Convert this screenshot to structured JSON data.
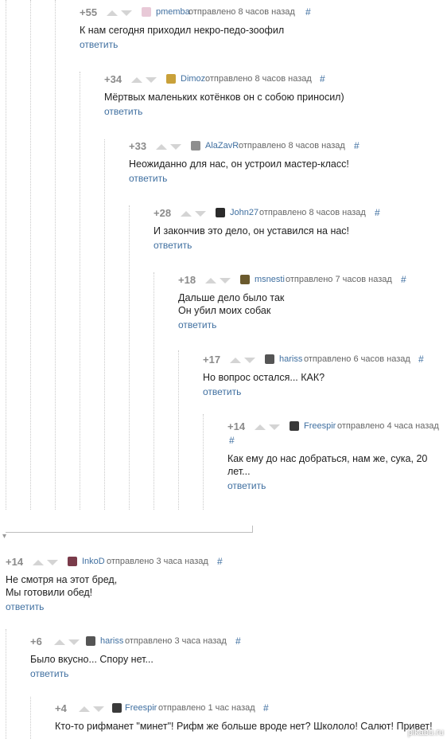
{
  "reply_label": "ответить",
  "hash": "#",
  "watermark": "pikabu.ru",
  "comments": [
    {
      "rating": "+55",
      "author": "pmemba",
      "time": "отправлено 8 часов назад",
      "text": "К нам сегодня приходил некро-педо-зоофил",
      "avatar_color": "#e8c9d7"
    },
    {
      "rating": "+34",
      "author": "Dimoz",
      "time": "отправлено 8 часов назад",
      "text": "Мёртвых маленьких котёнков он с собою приносил)",
      "avatar_color": "#c9a13a"
    },
    {
      "rating": "+33",
      "author": "AlaZavR",
      "time": "отправлено 8 часов назад",
      "text": "Неожиданно для нас, он устроил мастер-класс!",
      "avatar_color": "#8e8e8e"
    },
    {
      "rating": "+28",
      "author": "John27",
      "time": "отправлено 8 часов назад",
      "text": "И закончив это дело, он уставился на нас!",
      "avatar_color": "#2b2b2b"
    },
    {
      "rating": "+18",
      "author": "msnesti",
      "time": "отправлено 7 часов назад",
      "text": "Дальше дело было так\nОн убил моих собак",
      "avatar_color": "#6b5a2e"
    },
    {
      "rating": "+17",
      "author": "hariss",
      "time": "отправлено 6 часов назад",
      "text": "Но вопрос остался... КАК?",
      "avatar_color": "#555555"
    },
    {
      "rating": "+14",
      "author": "Freespir",
      "time": "отправлено 4 часа назад",
      "text": "Как ему до нас добраться, нам же, сука, 20\nлет...",
      "avatar_color": "#3a3a3a"
    },
    {
      "rating": "+14",
      "author": "InkoD",
      "time": "отправлено 3 часа назад",
      "text": "Не смотря на этот бред,\nМы готовили обед!",
      "avatar_color": "#7a3b4a"
    },
    {
      "rating": "+6",
      "author": "hariss",
      "time": "отправлено 3 часа назад",
      "text": "Было вкусно... Спору нет...",
      "avatar_color": "#555555"
    },
    {
      "rating": "+4",
      "author": "Freespir",
      "time": "отправлено 1 час назад",
      "text": "Кто-то рифманет \"минет\"! Рифм же больше вроде нет? Школоло! Салют! Привет!",
      "avatar_color": "#3a3a3a"
    }
  ]
}
